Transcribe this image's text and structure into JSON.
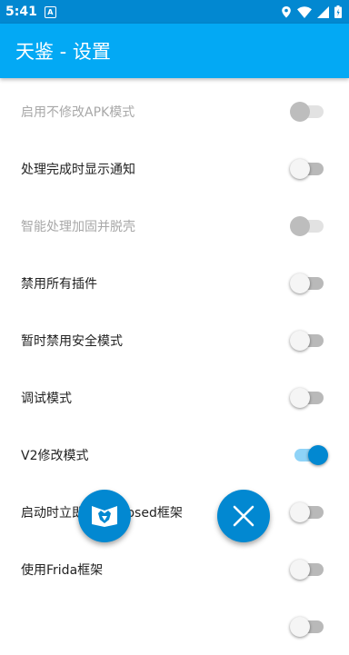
{
  "status_bar": {
    "time": "5:41",
    "notification_glyph": "A"
  },
  "app_bar": {
    "title": "天鉴 - 设置"
  },
  "colors": {
    "primary": "#03a9f4",
    "primary_dark": "#0288d1",
    "toggle_on": "#0288d1"
  },
  "settings": [
    {
      "label": "启用不修改APK模式",
      "enabled": false,
      "checked": false
    },
    {
      "label": "处理完成时显示通知",
      "enabled": true,
      "checked": false
    },
    {
      "label": "智能处理加固并脱壳",
      "enabled": false,
      "checked": false
    },
    {
      "label": "禁用所有插件",
      "enabled": true,
      "checked": false
    },
    {
      "label": "暂时禁用安全模式",
      "enabled": true,
      "checked": false
    },
    {
      "label": "调试模式",
      "enabled": true,
      "checked": false
    },
    {
      "label": "V2修改模式",
      "enabled": true,
      "checked": true
    },
    {
      "label": "启动时立即加载Xposed框架",
      "enabled": true,
      "checked": false
    },
    {
      "label": "使用Frida框架",
      "enabled": true,
      "checked": false
    }
  ],
  "fabs": {
    "left_icon": "fox-book-icon",
    "right_icon": "close-icon"
  }
}
